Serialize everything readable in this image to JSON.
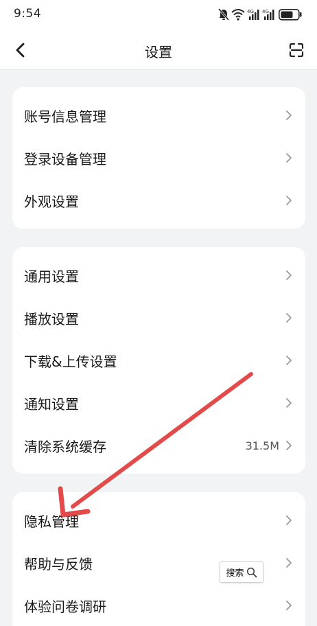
{
  "status_bar": {
    "time": "9:54",
    "icons": [
      "mute-bell-icon",
      "wifi-icon",
      "signal-4g-icon",
      "signal-4g-icon",
      "battery-icon"
    ],
    "network_1": "4G",
    "network_2": "4G"
  },
  "nav": {
    "title": "设置",
    "back_icon": "back-arrow-icon",
    "scan_icon": "scan-icon"
  },
  "groups": [
    {
      "items": [
        {
          "label": "账号信息管理"
        },
        {
          "label": "登录设备管理"
        },
        {
          "label": "外观设置"
        }
      ]
    },
    {
      "items": [
        {
          "label": "通用设置"
        },
        {
          "label": "播放设置"
        },
        {
          "label": "下载&上传设置"
        },
        {
          "label": "通知设置"
        },
        {
          "label": "清除系统缓存",
          "value": "31.5M"
        }
      ]
    },
    {
      "items": [
        {
          "label": "隐私管理"
        },
        {
          "label": "帮助与反馈"
        },
        {
          "label": "体验问卷调研"
        }
      ]
    }
  ],
  "search_badge": {
    "label": "搜索",
    "icon": "magnifier-icon"
  },
  "annotation": {
    "color": "#e34a4a"
  },
  "colors": {
    "background": "#f2f3f5",
    "card": "#ffffff",
    "chevron": "#9a9a9a"
  }
}
